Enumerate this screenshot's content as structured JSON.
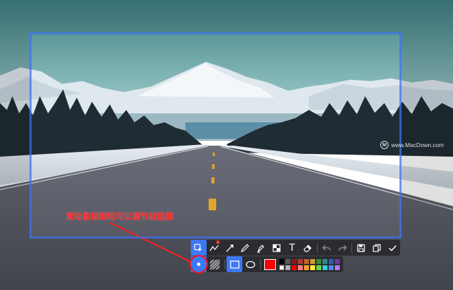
{
  "watermark": {
    "logo_glyph": "M",
    "text": "www.MacDown.com"
  },
  "annotation": {
    "text": "滑动鼠标滚轮可以调节线粗细",
    "color": "#ff1e1e"
  },
  "selection": {
    "border_color": "#3e6ff0"
  },
  "toolbar": {
    "accent": "#3d78f5",
    "background": "#2b2c30",
    "tools": [
      {
        "name": "region-select-icon",
        "active": true
      },
      {
        "name": "polyline-icon",
        "badge": true
      },
      {
        "name": "arrow-icon"
      },
      {
        "name": "pen-icon"
      },
      {
        "name": "highlighter-icon"
      },
      {
        "name": "mosaic-icon"
      },
      {
        "name": "text-icon",
        "glyph": "T"
      },
      {
        "name": "eraser-icon"
      },
      {
        "name": "undo-icon"
      },
      {
        "name": "redo-icon"
      },
      {
        "name": "save-icon"
      },
      {
        "name": "copy-icon"
      },
      {
        "name": "done-check-icon"
      }
    ]
  },
  "subbar": {
    "selected_color": "#ff0000",
    "palette": [
      "#000000",
      "#5a5a5a",
      "#8a1a1a",
      "#b03a2e",
      "#c8602a",
      "#c8a030",
      "#3a8a3a",
      "#2e8a8a",
      "#2e5fb0",
      "#6a3a9a",
      "#ffffff",
      "#b0b0b0",
      "#ff0000",
      "#ff7f7f",
      "#ff9933",
      "#ffee33",
      "#66dd44",
      "#33ccdd",
      "#4d8cff",
      "#b37dff"
    ]
  }
}
